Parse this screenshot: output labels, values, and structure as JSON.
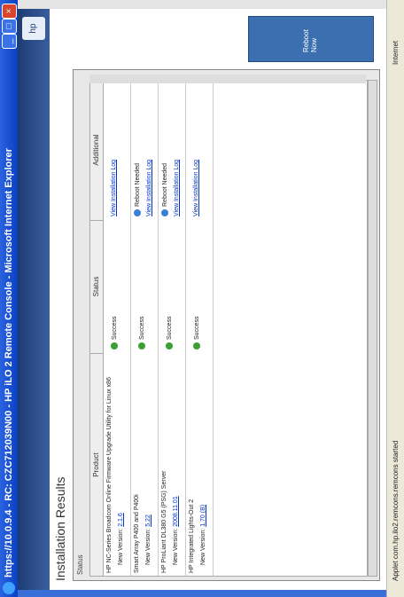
{
  "window": {
    "title": "https://10.0.9.4 - RC: CZC712039N00 - HP iLO 2 Remote Console - Microsoft Internet Explorer"
  },
  "page": {
    "title": "Installation Results",
    "panel_title": "Status"
  },
  "table": {
    "headers": [
      "Product",
      "Status",
      "Additional"
    ],
    "rows": [
      {
        "product": "HP NC-Series Broadcom Online Firmware Upgrade Utility for Linux x86",
        "new_version_label": "New Version:",
        "new_version": "2.1.6",
        "status": "Success",
        "additional": "View Installation Log"
      },
      {
        "product": "Smart Array P400 and P400i",
        "new_version_label": "New Version:",
        "new_version": "5.22",
        "status": "Success",
        "additional": "Reboot Needed",
        "additional2": "View Installation Log"
      },
      {
        "product": "HP ProLiant DL380 G5 (PSG) Server",
        "new_version_label": "New Version:",
        "new_version": "2008.11.01",
        "status": "Success",
        "additional": "Reboot Needed",
        "additional2": "View Installation Log"
      },
      {
        "product": "HP Integrated Lights-Out 2",
        "new_version_label": "New Version:",
        "new_version": "1.70 (B)",
        "status": "Success",
        "additional": "View Installation Log"
      }
    ]
  },
  "buttons": {
    "rescan": "Reboot Now"
  },
  "statusbar": {
    "text": "Applet com.hp.ilo2.remcons.remcons started",
    "zone": "Internet"
  }
}
